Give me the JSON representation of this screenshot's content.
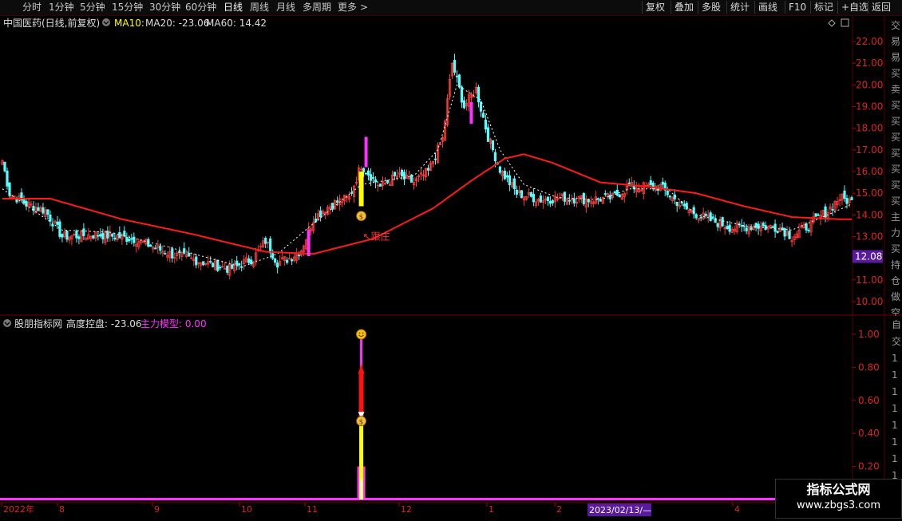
{
  "toolbar": {
    "periods": [
      "分时",
      "1分钟",
      "5分钟",
      "15分钟",
      "30分钟",
      "60分钟",
      "日线",
      "周线",
      "月线",
      "多周期",
      "更多"
    ],
    "active_period": "日线",
    "more_arrow": ">",
    "right_items": [
      "复权",
      "叠加",
      "多股",
      "统计",
      "画线",
      "F10",
      "标记",
      "+自选",
      "返回"
    ]
  },
  "main": {
    "title": "中国医药(日线,前复权)",
    "ma10_label": "MA10:",
    "ma20_label": "MA20: -23.06",
    "ma60_label": "MA60: 14.42",
    "price_tag": "12.08",
    "follow_label": "↖跟庄"
  },
  "indicator": {
    "name": "股朋指标网",
    "gkp_label": "高度控盘: -23.06",
    "model_label": "主力模型: 0.00"
  },
  "xaxis": {
    "labels": [
      "2022年",
      "8",
      "9",
      "10",
      "11",
      "12",
      "1",
      "2",
      "4"
    ],
    "crosshair_date": "2023/02/13/—"
  },
  "side_chars": [
    "交",
    "易",
    "易",
    "买",
    "卖",
    "买",
    "买",
    "买",
    "买",
    "买",
    "买",
    "买",
    "主",
    "力",
    "买",
    "持",
    "仓",
    "做",
    "空"
  ],
  "watermark": {
    "title": "指标公式网",
    "url": "www.zbgs3.com"
  },
  "colors": {
    "up": "#ff3b3b",
    "down": "#54ffff",
    "ma_main": "#ff1a1a",
    "ma_dash": "#ffffff",
    "yellow": "#ffff00",
    "magenta": "#ff33ff",
    "grid_red": "#5a0000",
    "purple_tag": "#5a1aa0"
  },
  "chart_data": [
    {
      "type": "candlestick",
      "title": "中国医药(日线,前复权)",
      "y_ticks": [
        22.0,
        21.0,
        20.0,
        19.0,
        18.0,
        17.0,
        16.0,
        15.0,
        14.0,
        13.0,
        12.0,
        11.0,
        10.0
      ],
      "ylim": [
        9.6,
        22.6
      ],
      "x_labels": [
        "2022年",
        "8",
        "9",
        "10",
        "11",
        "12",
        "1",
        "2",
        "4"
      ],
      "anchors": [
        [
          0,
          16.5
        ],
        [
          3,
          15.0
        ],
        [
          10,
          14.5
        ],
        [
          18,
          14.2
        ],
        [
          25,
          13.0
        ],
        [
          40,
          13.1
        ],
        [
          55,
          12.9
        ],
        [
          70,
          12.2
        ],
        [
          85,
          11.8
        ],
        [
          95,
          11.5
        ],
        [
          105,
          12.0
        ],
        [
          110,
          12.8
        ],
        [
          115,
          11.8
        ],
        [
          120,
          12.0
        ],
        [
          125,
          12.4
        ],
        [
          130,
          13.8
        ],
        [
          135,
          14.3
        ],
        [
          140,
          14.6
        ],
        [
          145,
          14.8
        ],
        [
          150,
          16.3
        ],
        [
          158,
          15.3
        ],
        [
          165,
          15.8
        ],
        [
          172,
          15.5
        ],
        [
          178,
          16.0
        ],
        [
          184,
          17.5
        ],
        [
          188,
          21.0
        ],
        [
          193,
          19.0
        ],
        [
          198,
          19.8
        ],
        [
          203,
          17.6
        ],
        [
          208,
          16.1
        ],
        [
          215,
          15.0
        ],
        [
          225,
          14.7
        ],
        [
          235,
          14.8
        ],
        [
          245,
          14.7
        ],
        [
          255,
          14.8
        ],
        [
          262,
          15.3
        ],
        [
          275,
          15.3
        ],
        [
          285,
          14.3
        ],
        [
          295,
          13.8
        ],
        [
          305,
          13.4
        ],
        [
          315,
          13.5
        ],
        [
          325,
          13.4
        ],
        [
          330,
          13.0
        ],
        [
          338,
          13.6
        ],
        [
          345,
          14.2
        ],
        [
          350,
          14.8
        ],
        [
          355,
          14.6
        ]
      ],
      "ma_long_anchors": [
        [
          0,
          14.75
        ],
        [
          20,
          14.75
        ],
        [
          50,
          13.8
        ],
        [
          80,
          13.1
        ],
        [
          110,
          12.3
        ],
        [
          130,
          12.2
        ],
        [
          155,
          12.9
        ],
        [
          180,
          14.3
        ],
        [
          195,
          15.5
        ],
        [
          210,
          16.6
        ],
        [
          218,
          16.8
        ],
        [
          230,
          16.4
        ],
        [
          250,
          15.5
        ],
        [
          270,
          15.3
        ],
        [
          290,
          15.0
        ],
        [
          310,
          14.4
        ],
        [
          330,
          13.9
        ],
        [
          350,
          13.8
        ]
      ],
      "ma_dash_anchors": [
        [
          0,
          15.2
        ],
        [
          25,
          13.3
        ],
        [
          45,
          13.2
        ],
        [
          70,
          12.5
        ],
        [
          100,
          11.6
        ],
        [
          115,
          12.2
        ],
        [
          130,
          13.6
        ],
        [
          150,
          15.4
        ],
        [
          172,
          15.8
        ],
        [
          182,
          17.0
        ],
        [
          190,
          20.0
        ],
        [
          200,
          19.3
        ],
        [
          208,
          17.0
        ],
        [
          218,
          15.4
        ],
        [
          232,
          14.8
        ],
        [
          250,
          14.7
        ],
        [
          262,
          15.2
        ],
        [
          278,
          15.2
        ],
        [
          290,
          14.0
        ],
        [
          310,
          13.5
        ],
        [
          330,
          13.3
        ],
        [
          345,
          14.0
        ],
        [
          355,
          14.5
        ]
      ],
      "signal_index": 150,
      "signal_bar_low": 14.4,
      "signal_bar_high": 16.0,
      "magenta_highlights": [
        [
          128,
          12.1,
          13.3
        ],
        [
          152,
          16.2,
          17.6
        ],
        [
          196,
          18.2,
          19.2
        ]
      ]
    },
    {
      "type": "bar",
      "title": "股朋指标网",
      "y_ticks": [
        1.0,
        0.8,
        0.6,
        0.4,
        0.2
      ],
      "ylim": [
        0.0,
        1.08
      ],
      "series": [
        {
          "name": "主力模型",
          "signal_index": 150,
          "values_at_signal": 1.0
        },
        {
          "name": "高度控盘",
          "value": -23.06
        }
      ],
      "marker_levels": {
        "smiley": 1.0,
        "money_bag": 0.47,
        "arrow_top": 0.78
      }
    }
  ]
}
